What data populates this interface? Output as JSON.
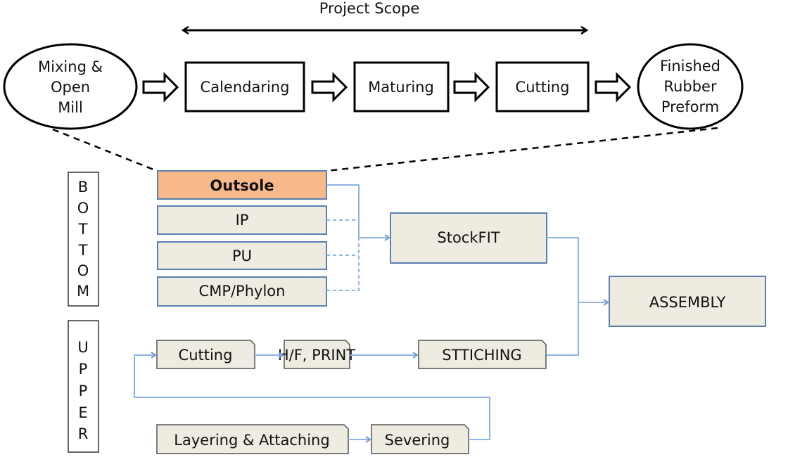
{
  "scope": {
    "label": "Project Scope"
  },
  "top_flow": {
    "start": [
      "Mixing &",
      "Open",
      "Mill"
    ],
    "steps": [
      "Calendaring",
      "Maturing",
      "Cutting"
    ],
    "end": [
      "Finished",
      "Rubber",
      "Preform"
    ]
  },
  "bottom": {
    "label_letters": [
      "B",
      "O",
      "T",
      "T",
      "O",
      "M"
    ],
    "parts": [
      "Outsole",
      "IP",
      "PU",
      "CMP/Phylon"
    ],
    "stockfit": "StockFIT",
    "assembly": "ASSEMBLY"
  },
  "upper": {
    "label_letters": [
      "U",
      "P",
      "P",
      "E",
      "R"
    ],
    "row1": [
      "Cutting",
      "H/F, PRINT",
      "STTICHING"
    ],
    "row2": [
      "Layering & Attaching",
      "Severing"
    ]
  },
  "colors": {
    "highlight": "#f8b98b",
    "box_fill": "#eeece1",
    "connector": "#8db3e2",
    "box_border": "#5b7fb0"
  }
}
